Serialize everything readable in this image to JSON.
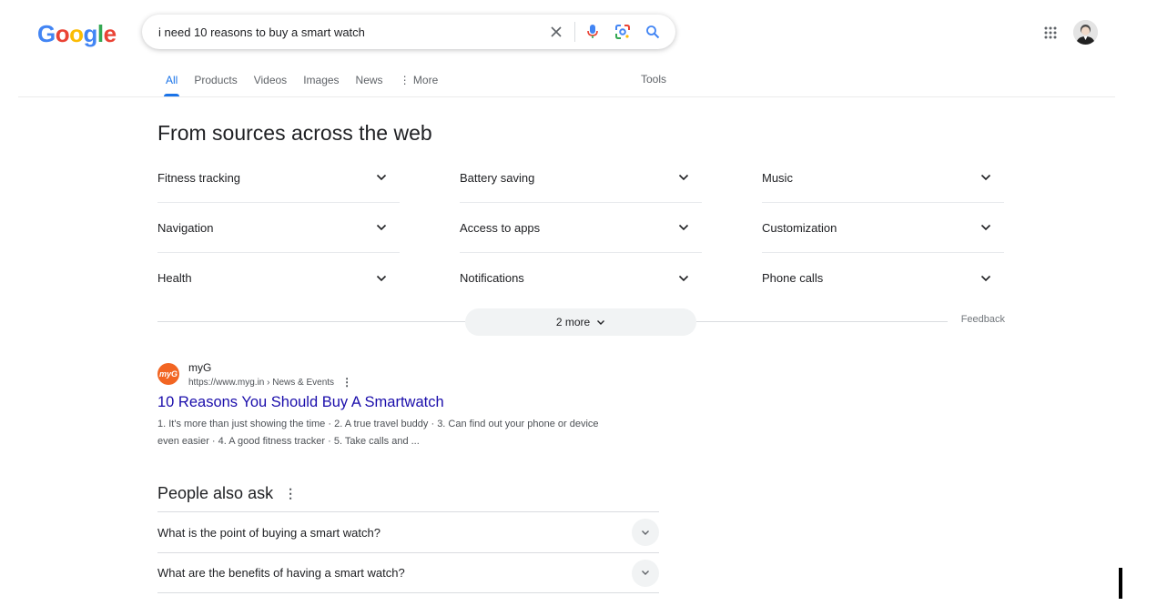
{
  "brand": {
    "logo_letters": [
      "G",
      "o",
      "o",
      "g",
      "l",
      "e"
    ],
    "logo_colors": [
      "#4285F4",
      "#EA4335",
      "#FBBC05",
      "#4285F4",
      "#34A853",
      "#EA4335"
    ]
  },
  "search": {
    "query": "i need 10 reasons to buy a smart watch",
    "icons": [
      "close-icon",
      "microphone-icon",
      "lens-icon",
      "search-icon"
    ]
  },
  "header": {
    "apps_icon": "apps-grid-icon",
    "avatar_icon": "user-avatar"
  },
  "tabs": [
    {
      "label": "All",
      "active": true
    },
    {
      "label": "Products",
      "active": false
    },
    {
      "label": "Videos",
      "active": false
    },
    {
      "label": "Images",
      "active": false
    },
    {
      "label": "News",
      "active": false
    },
    {
      "label": "⋮ More",
      "active": false
    }
  ],
  "tools_label": "Tools",
  "sources": {
    "heading": "From sources across the web",
    "items": [
      "Fitness tracking",
      "Navigation",
      "Health",
      "Battery saving",
      "Access to apps",
      "Notifications",
      "Music",
      "Customization",
      "Phone calls"
    ],
    "more_label": "2 more",
    "feedback_label": "Feedback"
  },
  "result": {
    "favicon_text": "myG",
    "site_name": "myG",
    "url": "https://www.myg.in › News & Events",
    "title": "10 Reasons You Should Buy A Smartwatch",
    "snippet": "1. It's more than just showing the time · 2. A true travel buddy · 3. Can find out your phone or device even easier · 4. A good fitness tracker · 5. Take calls and ..."
  },
  "people_also_ask": {
    "heading": "People also ask",
    "questions": [
      "What is the point of buying a smart watch?",
      "What are the benefits of having a smart watch?"
    ]
  },
  "colors": {
    "accent": "#1a73e8",
    "link": "#1a0dab",
    "favicon_bg": "#f26522"
  }
}
